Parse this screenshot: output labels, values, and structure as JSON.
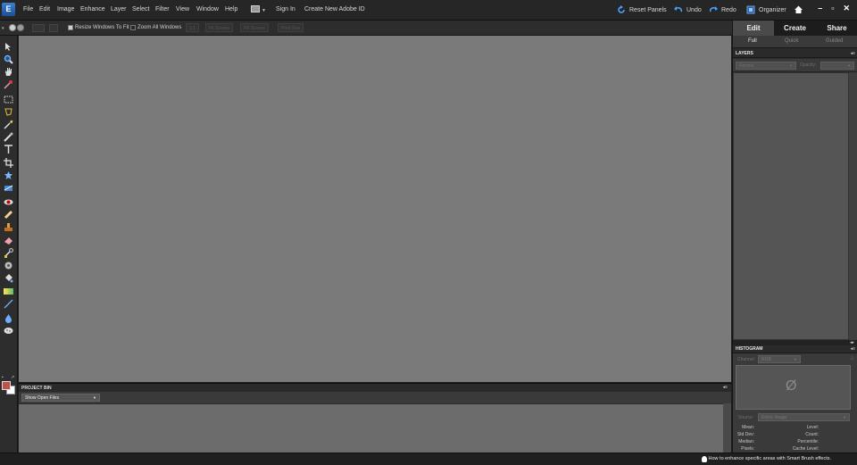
{
  "menubar": {
    "logo": "E",
    "items": [
      "File",
      "Edit",
      "Image",
      "Enhance",
      "Layer",
      "Select",
      "Filter",
      "View",
      "Window",
      "Help"
    ],
    "sign_in": "Sign In",
    "create_id": "Create New Adobe ID",
    "reset_panels": "Reset Panels",
    "undo": "Undo",
    "redo": "Redo",
    "organizer": "Organizer",
    "minimize": "–",
    "restore": "▫",
    "close": "✕"
  },
  "options": {
    "resize_windows": "Resize Windows To Fit",
    "zoom_all": "Zoom All Windows",
    "btn_1to1": "1:1",
    "btn_fit": "Fit Screen",
    "btn_fill": "Fill Screen",
    "btn_print": "Print Size"
  },
  "tools": [
    "move-icon",
    "zoom-icon",
    "hand-icon",
    "eyedropper-icon",
    "marquee-icon",
    "lasso-icon",
    "magic-wand-icon",
    "quick-selection-icon",
    "type-icon",
    "crop-icon",
    "cookie-cutter-icon",
    "straighten-icon",
    "red-eye-icon",
    "healing-brush-icon",
    "clone-stamp-icon",
    "eraser-icon",
    "brush-icon",
    "smart-brush-icon",
    "paint-bucket-icon",
    "gradient-icon",
    "shape-icon",
    "blur-icon",
    "sponge-icon"
  ],
  "colors": {
    "foreground": "#c0504d",
    "background": "#ffffff",
    "canvas": "#7a7a7a",
    "accent": "#3a7bd5"
  },
  "project_bin": {
    "title": "PROJECT BIN",
    "select_value": "Show Open Files"
  },
  "status": {
    "tip": "How to enhance specific areas with Smart Brush effects."
  },
  "right_panel": {
    "tabs": {
      "edit": "Edit",
      "create": "Create",
      "share": "Share"
    },
    "subtabs": {
      "full": "Full",
      "quick": "Quick",
      "guided": "Guided"
    },
    "layers": {
      "title": "LAYERS",
      "blend_mode": "Normal",
      "opacity_label": "Opacity:"
    },
    "histogram": {
      "title": "HISTOGRAM",
      "channel_label": "Channel:",
      "channel_value": "RGB",
      "source_label": "Source:",
      "source_value": "Entire Image",
      "stats_left": [
        "Mean:",
        "Std Dev:",
        "Median:",
        "Pixels:"
      ],
      "stats_right": [
        "Level:",
        "Count:",
        "Percentile:",
        "Cache Level:"
      ],
      "empty_symbol": "Ø"
    }
  }
}
